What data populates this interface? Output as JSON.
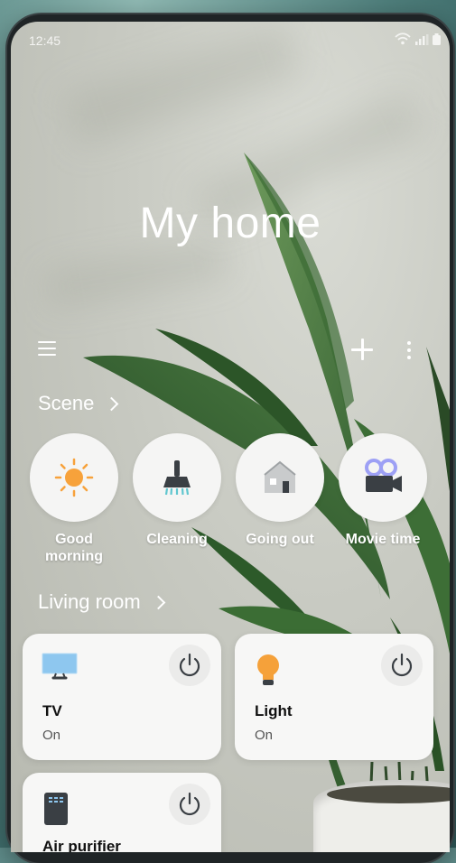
{
  "status_bar": {
    "time": "12:45"
  },
  "header": {
    "title": "My home"
  },
  "scene_section": {
    "title": "Scene",
    "items": [
      {
        "label_line1": "Good",
        "label_line2": "morning",
        "icon": "sun-icon"
      },
      {
        "label_line1": "Cleaning",
        "label_line2": "",
        "icon": "broom-icon"
      },
      {
        "label_line1": "Going out",
        "label_line2": "",
        "icon": "house-icon"
      },
      {
        "label_line1": "Movie time",
        "label_line2": "",
        "icon": "camera-icon"
      }
    ]
  },
  "room_section": {
    "title": "Living room",
    "devices": [
      {
        "name": "TV",
        "state": "On",
        "icon": "tv-icon"
      },
      {
        "name": "Light",
        "state": "On",
        "icon": "bulb-icon"
      },
      {
        "name": "Air purifier",
        "state": "",
        "icon": "air-purifier-icon"
      }
    ]
  },
  "colors": {
    "accent_orange": "#f5a13a",
    "tv_blue": "#8ec7ef",
    "movie_purple": "#9da0f5"
  }
}
